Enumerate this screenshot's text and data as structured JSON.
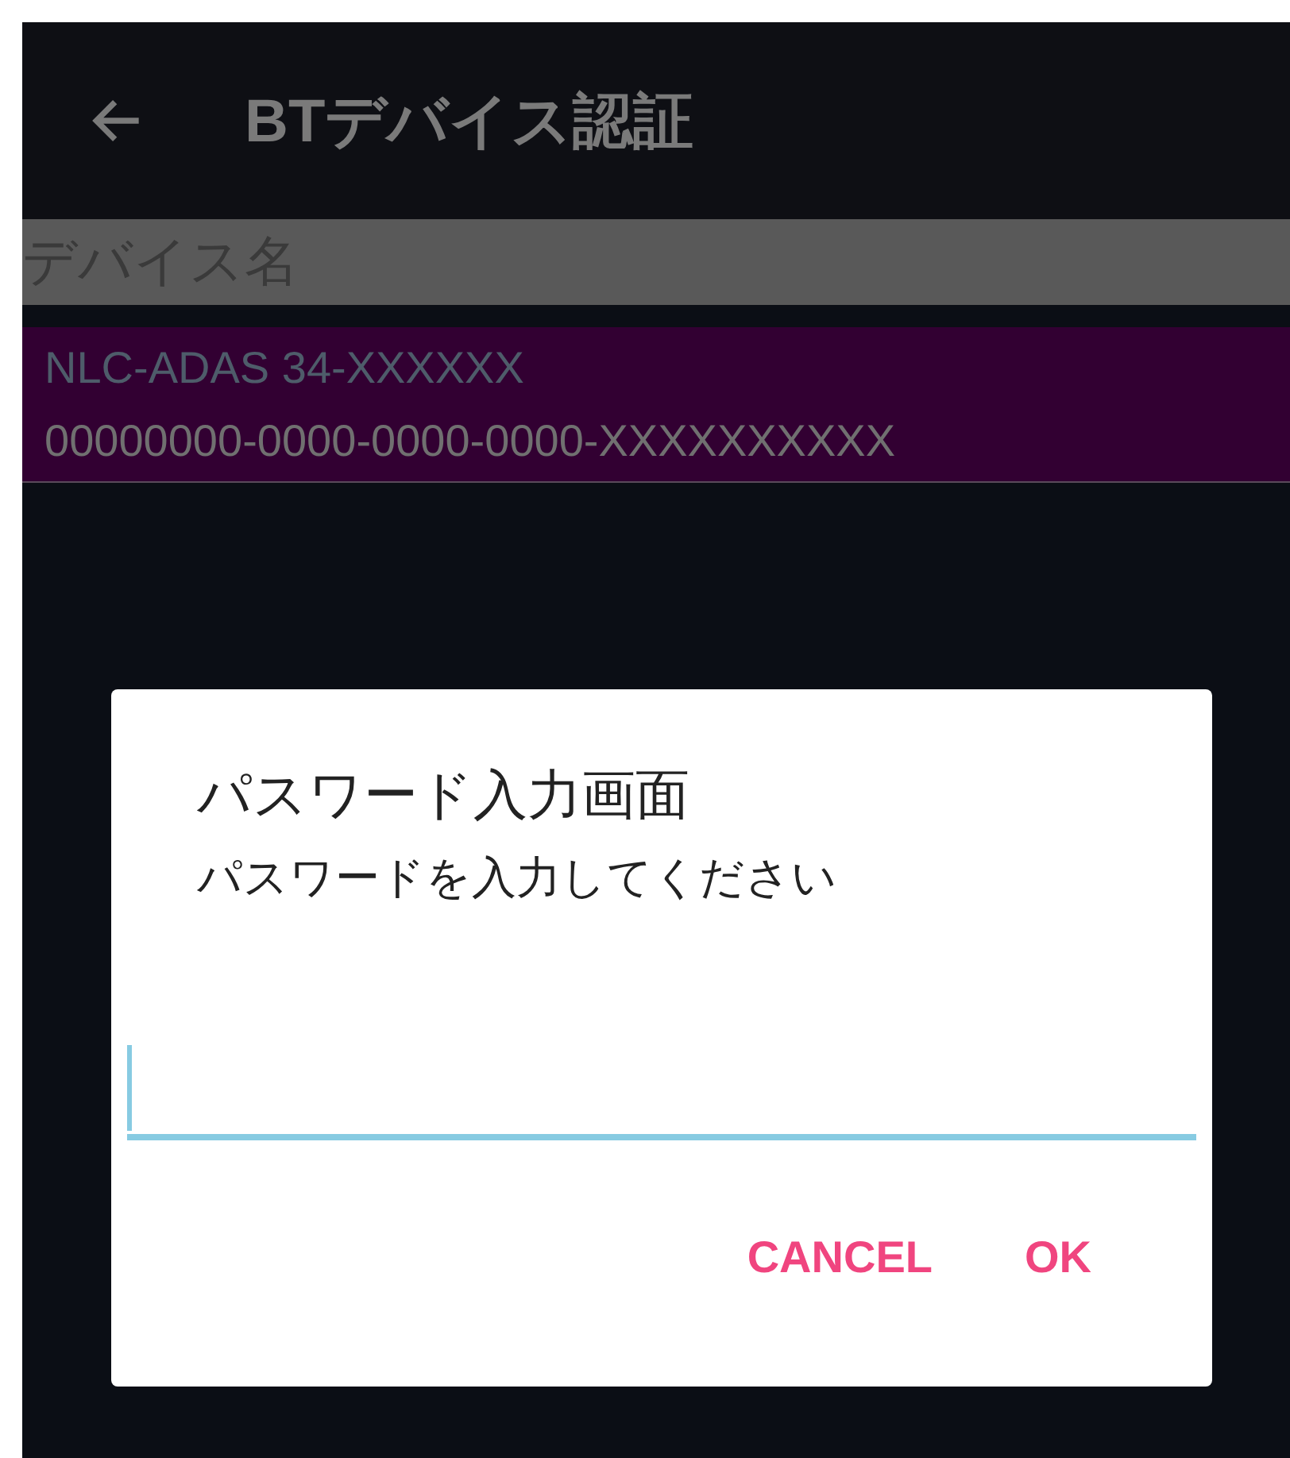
{
  "app_bar": {
    "back": true,
    "title": "BTデバイス認証"
  },
  "list_header": "デバイス名",
  "devices": [
    {
      "name": "NLC-ADAS 34-XXXXXX",
      "uuid": "00000000-0000-0000-0000-XXXXXXXXXX",
      "selected": true
    }
  ],
  "dialog": {
    "title": "パスワード入力画面",
    "message": "パスワードを入力してください",
    "password_field": {
      "focused": true
    },
    "buttons": [
      "CANCEL",
      "OK"
    ]
  }
}
